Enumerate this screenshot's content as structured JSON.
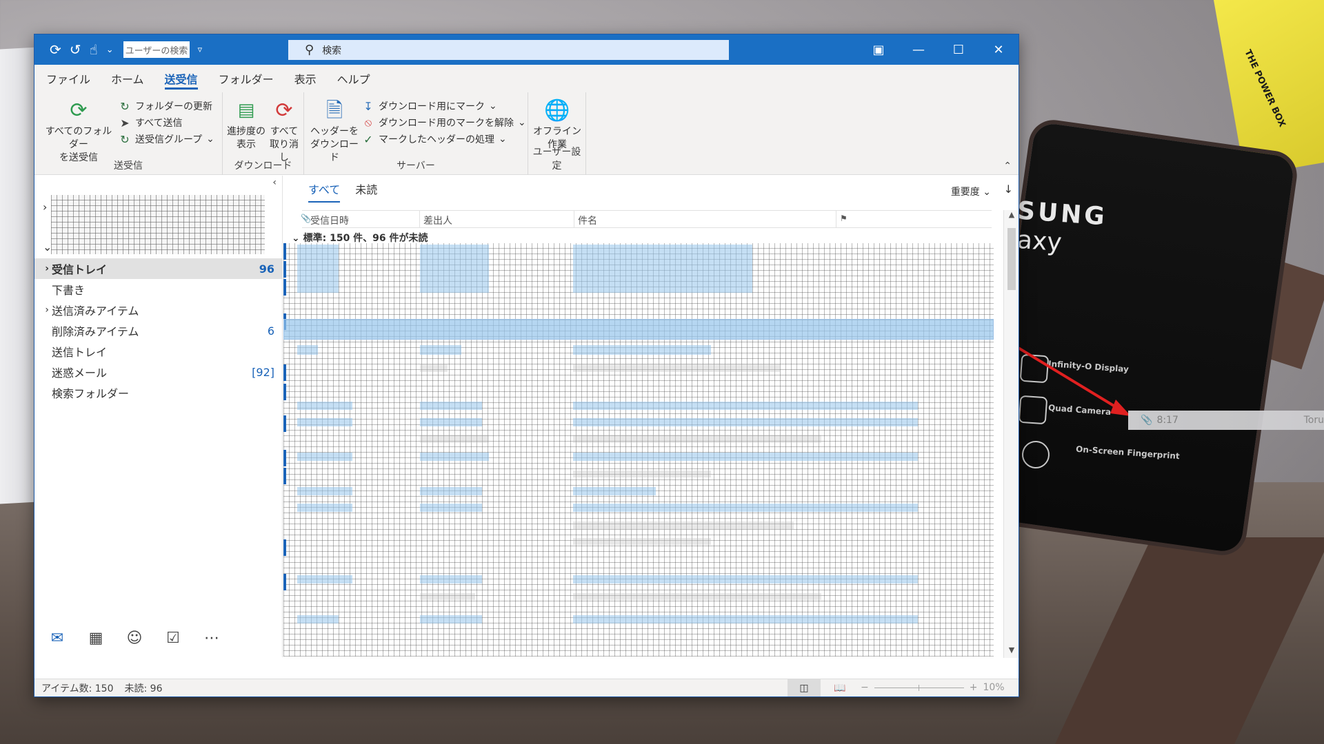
{
  "background": {
    "phone_brand": "SUNG",
    "phone_model": "axy",
    "phone_features": [
      "Infinity-O Display",
      "Quad Camera",
      "On-Screen Fingerprint"
    ],
    "box_text": "THE POWER BOX",
    "callout": {
      "time": "8:17",
      "sender": "Toru"
    }
  },
  "titlebar": {
    "quick_access": [
      "sync-icon",
      "undo-icon",
      "touch-mode-icon"
    ],
    "user_search_placeholder": "ユーザーの検索",
    "search_label": "検索",
    "controls": [
      "ribbon-display-icon",
      "minimize-icon",
      "maximize-icon",
      "close-icon"
    ]
  },
  "menu": {
    "tabs": [
      "ファイル",
      "ホーム",
      "送受信",
      "フォルダー",
      "表示",
      "ヘルプ"
    ],
    "active": "送受信"
  },
  "ribbon": {
    "groups": [
      {
        "name": "送受信",
        "big": {
          "line1": "すべてのフォルダー",
          "line2": "を送受信"
        },
        "small": [
          "フォルダーの更新",
          "すべて送信",
          "送受信グループ"
        ]
      },
      {
        "name": "ダウンロード",
        "buttons": [
          {
            "line1": "進捗度の",
            "line2": "表示"
          },
          {
            "line1": "すべて",
            "line2": "取り消し"
          }
        ]
      },
      {
        "name": "サーバー",
        "big": {
          "line1": "ヘッダーを",
          "line2": "ダウンロード"
        },
        "small": [
          "ダウンロード用にマーク",
          "ダウンロード用のマークを解除",
          "マークしたヘッダーの処理"
        ]
      },
      {
        "name": "ユーザー設定",
        "big": {
          "line1": "オフライン",
          "line2": "作業"
        }
      }
    ]
  },
  "folders": [
    {
      "label": "受信トレイ",
      "count": "96",
      "expandable": true,
      "selected": true
    },
    {
      "label": "下書き",
      "count": ""
    },
    {
      "label": "送信済みアイテム",
      "count": "",
      "expandable": true
    },
    {
      "label": "削除済みアイテム",
      "count": "6"
    },
    {
      "label": "送信トレイ",
      "count": ""
    },
    {
      "label": "迷惑メール",
      "count": "[92]"
    },
    {
      "label": "検索フォルダー",
      "count": ""
    }
  ],
  "nav_icons": [
    "mail-icon",
    "calendar-icon",
    "people-icon",
    "tasks-icon",
    "more-icon"
  ],
  "message_list": {
    "filters": [
      "すべて",
      "未読"
    ],
    "active_filter": "すべて",
    "sort_label": "重要度",
    "columns": [
      "受信日時",
      "差出人",
      "件名"
    ],
    "group_header": "標準: 150 件、96 件が未読"
  },
  "status": {
    "items": "アイテム数: 150",
    "unread": "未読: 96",
    "zoom": "10%"
  }
}
